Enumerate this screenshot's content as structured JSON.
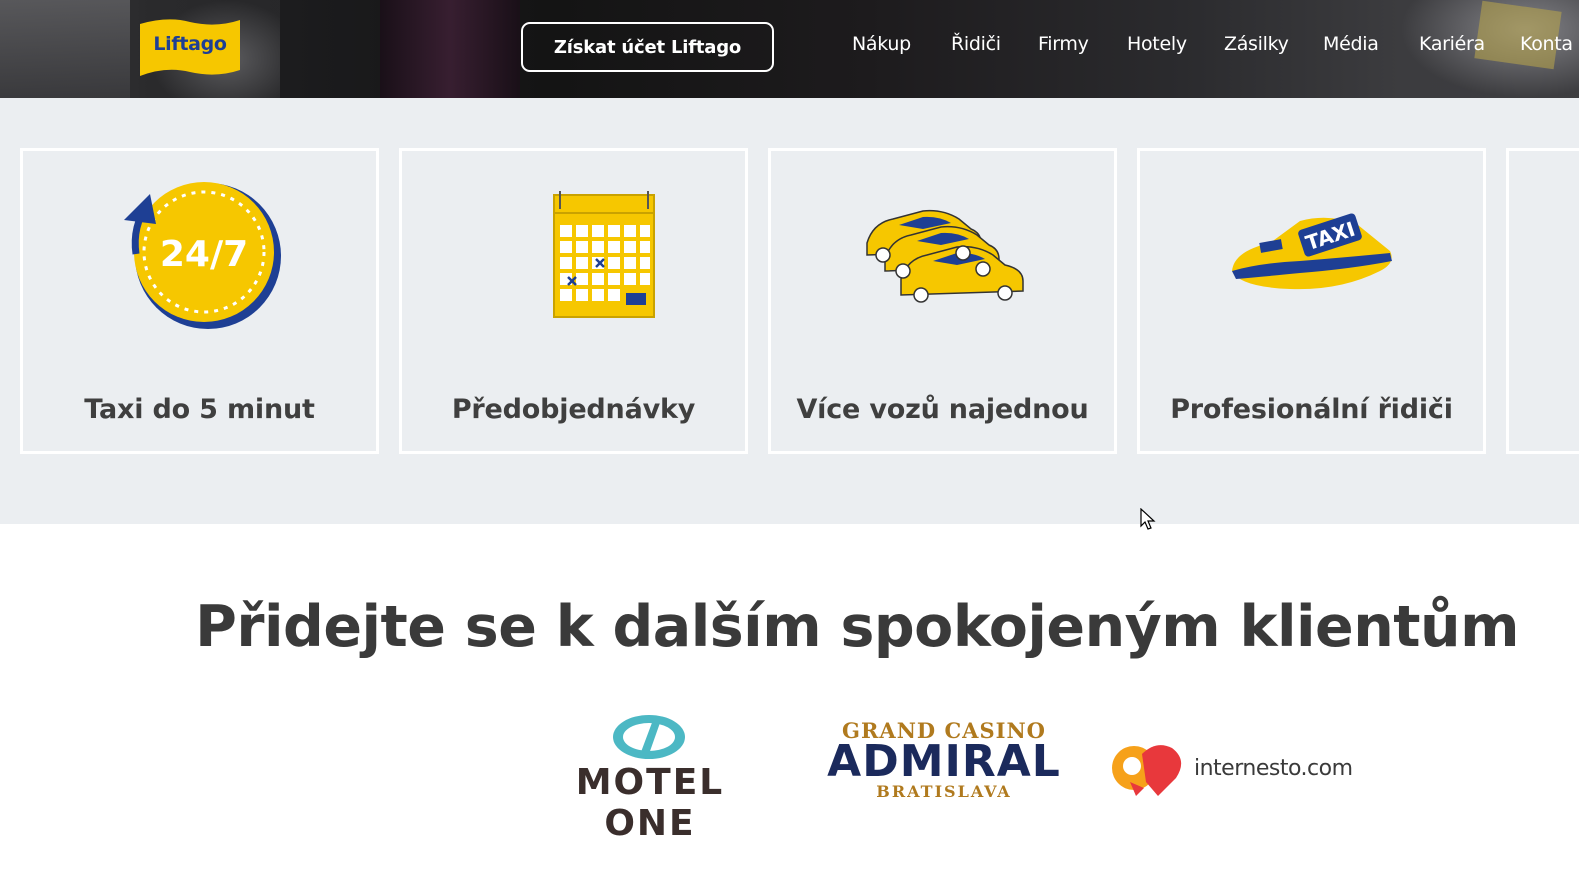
{
  "header": {
    "logo_text": "Liftago",
    "cta_label": "Získat účet Liftago",
    "nav": [
      {
        "label": "Nákup"
      },
      {
        "label": "Řidiči"
      },
      {
        "label": "Firmy"
      },
      {
        "label": "Hotely"
      },
      {
        "label": "Zásilky"
      },
      {
        "label": "Média"
      },
      {
        "label": "Kariéra"
      },
      {
        "label": "Konta"
      }
    ]
  },
  "features": [
    {
      "title": "Taxi do 5 minut",
      "icon": "clock-24-7-icon",
      "icon_text": "24/7"
    },
    {
      "title": "Předobjednávky",
      "icon": "calendar-icon"
    },
    {
      "title": "Více vozů najednou",
      "icon": "taxi-cars-icon"
    },
    {
      "title": "Profesionální řidiči",
      "icon": "taxi-cap-icon",
      "icon_text": "TAXI"
    }
  ],
  "clients": {
    "title": "Přidejte se k dalším spokojeným klientům",
    "logos": [
      {
        "name": "motel-one-logo",
        "text": "MOTEL ONE"
      },
      {
        "name": "grand-casino-admiral-logo",
        "line1": "GRAND CASINO",
        "line2": "ADMIRAL",
        "line3": "BRATISLAVA"
      },
      {
        "name": "internesto-logo",
        "text": "internesto.com"
      }
    ]
  },
  "colors": {
    "brand_yellow": "#f6c700",
    "brand_blue": "#1e3f94",
    "band_bg": "#ebeef1",
    "title_text": "#3a3a3a"
  }
}
